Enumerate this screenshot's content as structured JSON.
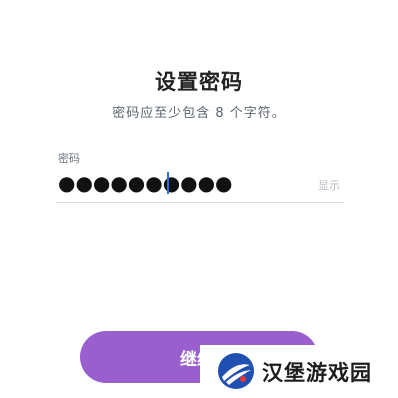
{
  "header": {
    "title": "设置密码",
    "subtitle": "密码应至少包含 8 个字符。"
  },
  "password": {
    "label": "密码",
    "masked_value": "●●●●●●●●●●",
    "show_label": "显示"
  },
  "actions": {
    "continue_label": "继续"
  },
  "watermark": {
    "text": "汉堡游戏园"
  },
  "colors": {
    "accent": "#9a5fcf",
    "caret": "#2f6fdb"
  }
}
